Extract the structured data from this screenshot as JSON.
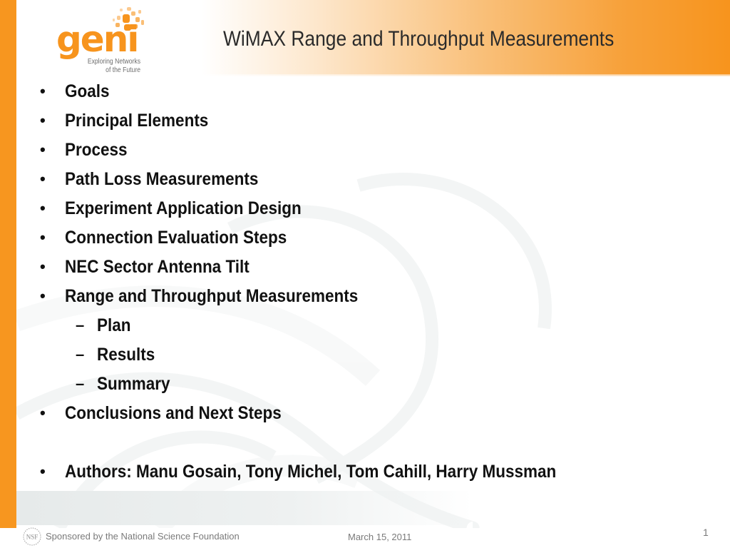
{
  "header": {
    "logo": {
      "wordmark": "geni",
      "tagline_line1": "Exploring Networks",
      "tagline_line2": "of the Future",
      "icon": "geni-globe-icon"
    },
    "title": "WiMAX Range and Throughput Measurements"
  },
  "colors": {
    "accent_orange": "#f7941d",
    "title_text": "#2b2b2b",
    "body_text": "#111111",
    "footer_text": "#7a7a7a"
  },
  "bullets": [
    {
      "marker": "•",
      "text": "Goals",
      "level": 1
    },
    {
      "marker": "•",
      "text": "Principal Elements",
      "level": 1
    },
    {
      "marker": "•",
      "text": "Process",
      "level": 1
    },
    {
      "marker": "•",
      "text": "Path Loss Measurements",
      "level": 1
    },
    {
      "marker": "•",
      "text": "Experiment Application Design",
      "level": 1
    },
    {
      "marker": "•",
      "text": "Connection Evaluation Steps",
      "level": 1
    },
    {
      "marker": "•",
      "text": "NEC Sector Antenna Tilt",
      "level": 1
    },
    {
      "marker": "•",
      "text": "Range and Throughput Measurements",
      "level": 1
    },
    {
      "marker": "–",
      "text": "Plan",
      "level": 2
    },
    {
      "marker": "–",
      "text": "Results",
      "level": 2
    },
    {
      "marker": "–",
      "text": "Summary",
      "level": 2
    },
    {
      "marker": "•",
      "text": "Conclusions and Next Steps",
      "level": 1
    },
    {
      "marker": "•",
      "text": "Authors:  Manu Gosain, Tony Michel, Tom Cahill, Harry Mussman",
      "level": 1
    }
  ],
  "footer": {
    "nsf_logo_text": "NSF",
    "sponsor": "Sponsored by the National Science Foundation",
    "date": "March 15, 2011",
    "page_number": "1"
  }
}
